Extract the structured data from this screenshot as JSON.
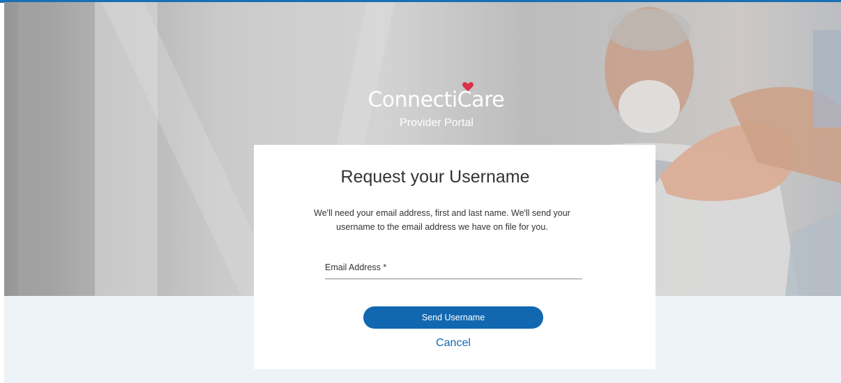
{
  "brand": {
    "name_prefix": "Connecti",
    "name_suffix": "Care",
    "trademark": ".",
    "subtitle": "Provider Portal"
  },
  "form": {
    "title": "Request your Username",
    "description": "We'll need your email address, first and last name. We'll send your username to the email address we have on file for you.",
    "email_label": "Email Address *",
    "email_value": "",
    "submit_label": "Send Username",
    "cancel_label": "Cancel"
  },
  "colors": {
    "accent": "#1168b1",
    "heart": "#d8334a",
    "footer_background": "#edf3f6"
  }
}
